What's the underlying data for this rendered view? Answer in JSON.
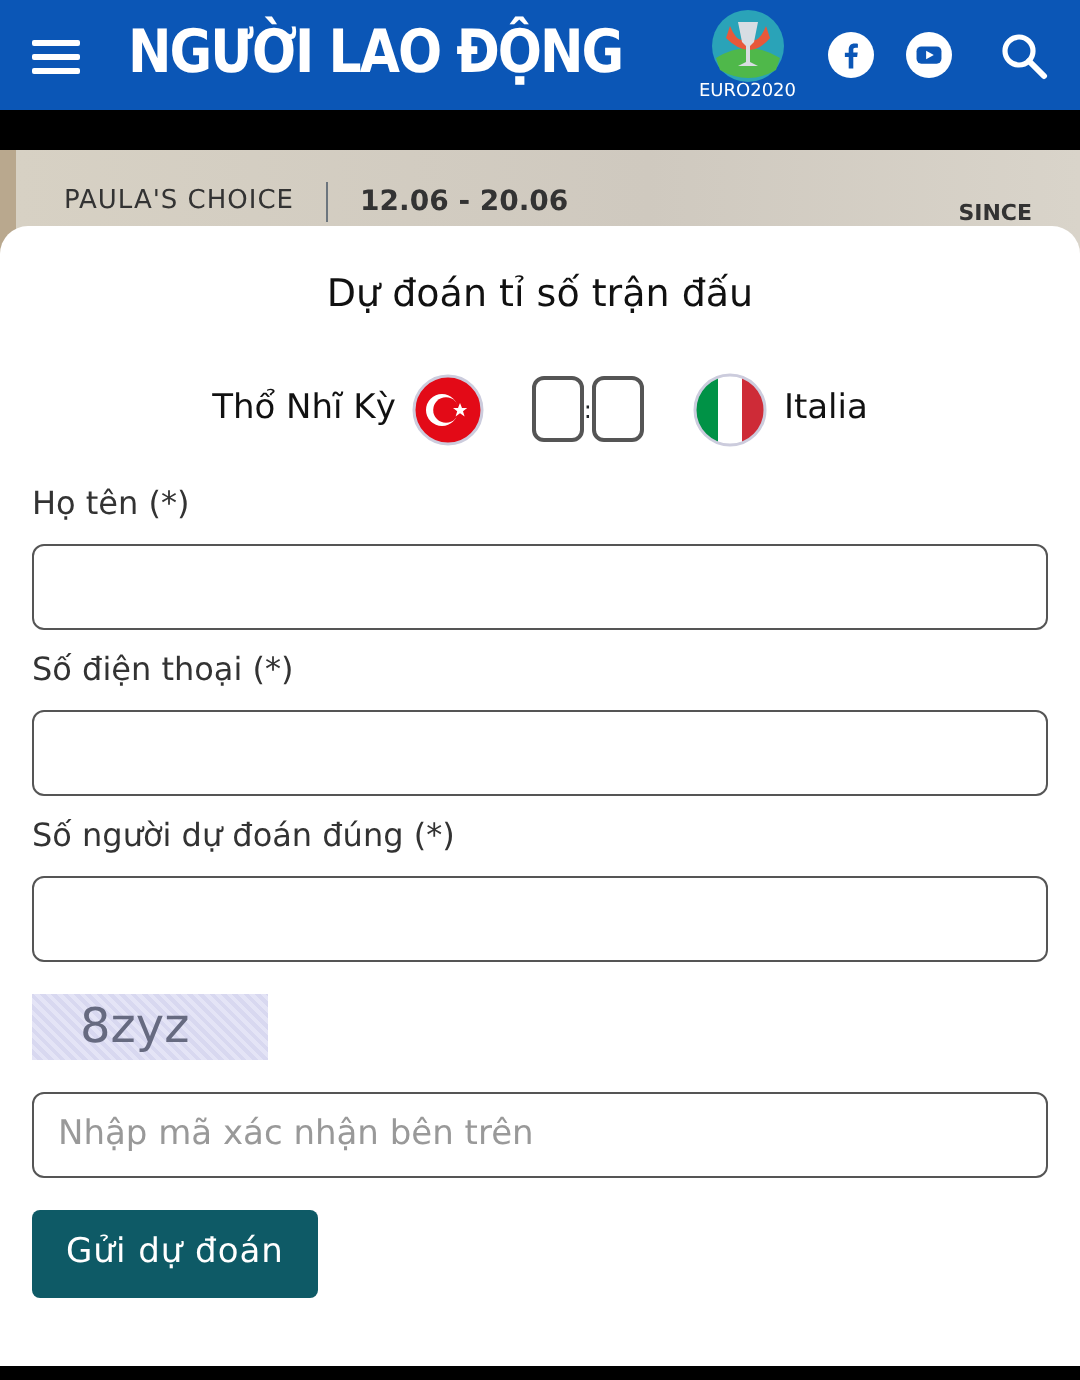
{
  "header": {
    "logo": "NGƯỜI LAO ĐỘNG",
    "badge": "EURO2020"
  },
  "banner": {
    "brand": "PAULA'S CHOICE",
    "dates": "12.06 - 20.06",
    "tagline": "SINCE"
  },
  "modal": {
    "title": "Dự đoán tỉ số trận đấu",
    "match": {
      "home": {
        "name": "Thổ Nhĩ Kỳ",
        "kind": "turkey"
      },
      "separator": ":",
      "away": {
        "name": "Italia",
        "kind": "italy"
      }
    },
    "fields": [
      {
        "label": "Họ tên (*)"
      },
      {
        "label": "Số điện thoại (*)"
      },
      {
        "label": "Số người dự đoán đúng (*)"
      }
    ],
    "captcha": "8zyz",
    "captcha_field": {
      "placeholder": "Nhập mã xác nhận bên trên"
    },
    "submit": "Gửi dự đoán"
  }
}
